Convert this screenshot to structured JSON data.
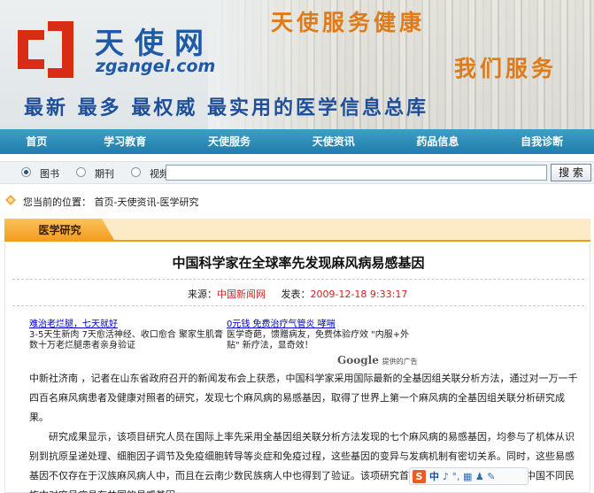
{
  "banner": {
    "logo_cn": "天使网",
    "logo_en": "zgangel.com",
    "slogan_top": "天使服务健康",
    "slogan_right": "我们服务",
    "slogan_bottom": "最新 最多 最权威 最实用的医学信息总库",
    "colors": {
      "logo": "#1f5aa8",
      "logo_mark": "#d92c14",
      "slogan": "#e07b1a"
    }
  },
  "nav": {
    "items": [
      "首页",
      "学习教育",
      "天使服务",
      "天使资讯",
      "药品信息",
      "自我诊断"
    ],
    "color": "#2a8cb8"
  },
  "search": {
    "options": [
      {
        "label": "图书",
        "checked": true
      },
      {
        "label": "期刊",
        "checked": false
      },
      {
        "label": "视频",
        "checked": false
      }
    ],
    "query": "",
    "button_label": "搜 索"
  },
  "breadcrumb": {
    "prefix": "您当前的位置：",
    "path": "首页-天使资讯-医学研究",
    "icon": "location-icon"
  },
  "section": {
    "tab_label": "医学研究",
    "accent": "#f39a1e"
  },
  "article": {
    "title": "中国科学家在全球率先发现麻风病易感基因",
    "source_label": "来源：",
    "source": "中国新闻网",
    "published_label": "发表：",
    "published": "2009-12-18 9:33:17",
    "ads": [
      {
        "link": "难治老烂腿，七天就好",
        "desc": "3-5天生新肉 7天愈活神经、收口愈合 聚家生肌膏 数十万老烂腿患者亲身验证"
      },
      {
        "link": "0元钱 免费治疗气管炎 哮喘",
        "desc": "医学奇葩，馈赠病友，免费体验疗效 \"内服+外贴\" 新疗法，显奇效！"
      }
    ],
    "ads_provider": "Google",
    "ads_provider_suffix": "提供的广告",
    "paragraphs": [
      "中新社济南 ，记者在山东省政府召开的新闻发布会上获悉，中国科学家采用国际最新的全基因组关联分析方法，通过对一万一千四百名麻风病患者及健康对照者的研究，发现七个麻风病的易感基因，取得了世界上第一个麻风病的全基因组关联分析研究成果。",
      "研究成果显示，该项目研究人员在国际上率先采用全基因组关联分析方法发现的七个麻风病的易感基因，均参与了机体从识别到抗原呈递处理、细胞因子调节及免疫细胞转导等炎症和免疫过程，这些基因的变异与发病机制有密切关系。同时，这些易感基因不仅存在于汉族麻风病人中，而且在云南少数民族病人中也得到了验证。该项研究首次通过遗传学研究证明了在中国不同民族中对麻风病具有共同的易感基因。"
    ]
  },
  "ime": {
    "mode": "中",
    "glyphs": "♪ °, ▦ ♟ ✎"
  }
}
